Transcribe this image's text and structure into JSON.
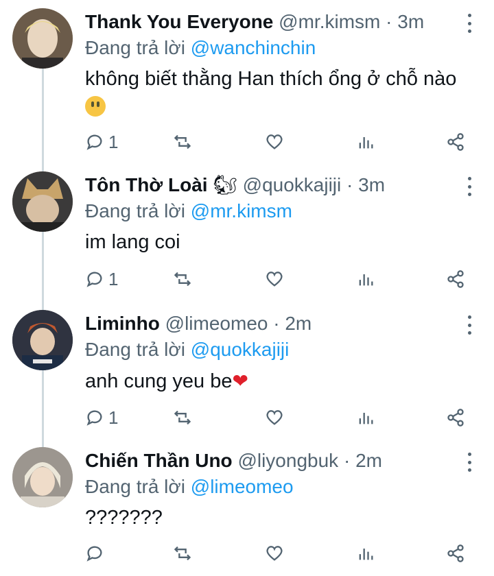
{
  "tweets": [
    {
      "name": "Thank You Everyone",
      "handle": "@mr.kimsm",
      "sep": "·",
      "time": "3m",
      "replying_prefix": "Đang trả lời",
      "replying_to": "@wanchinchin",
      "text": "không biết thằng Han thích ổng ở chỗ nào",
      "emoji": "grinning-face",
      "reply_count": "1",
      "avatar_color": "#c9b59a"
    },
    {
      "name": "Tôn Thờ Loài",
      "name_emoji": "🐿",
      "handle": "@quokkajiji",
      "sep": "·",
      "time": "3m",
      "replying_prefix": "Đang trả lời",
      "replying_to": "@mr.kimsm",
      "text": "im lang coi",
      "reply_count": "1",
      "avatar_color": "#8a7a63"
    },
    {
      "name": "Liminho",
      "handle": "@limeomeo",
      "sep": "·",
      "time": "2m",
      "replying_prefix": "Đang trả lời",
      "replying_to": "@quokkajiji",
      "text": "anh cung yeu be",
      "emoji": "❤",
      "reply_count": "1",
      "avatar_color": "#4b4f5a"
    },
    {
      "name": "Chiến Thần Uno",
      "handle": "@liyongbuk",
      "sep": "·",
      "time": "2m",
      "replying_prefix": "Đang trả lời",
      "replying_to": "@limeomeo",
      "text": "???????",
      "reply_count": "",
      "avatar_color": "#b8b3ad"
    }
  ],
  "colors": {
    "accent": "#1d9bf0",
    "muted": "#536471",
    "thread_line": "#cfd9de"
  }
}
